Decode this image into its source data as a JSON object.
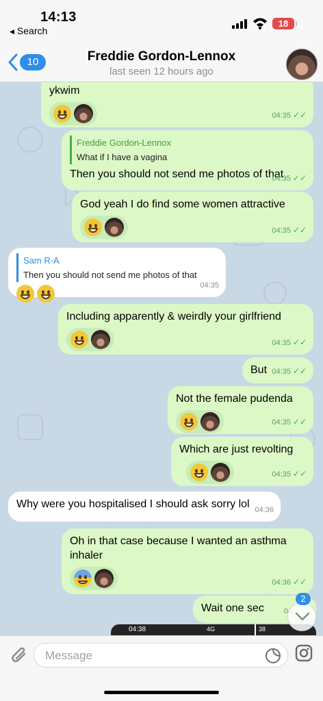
{
  "status_bar": {
    "time": "14:13",
    "back_label": "Search",
    "battery": "18"
  },
  "header": {
    "back_count": "10",
    "title": "Freddie Gordon-Lennox",
    "subtitle": "last seen 12 hours ago"
  },
  "messages": [
    {
      "side": "out",
      "text": "ykwim",
      "time": "04:35"
    },
    {
      "side": "out",
      "quote_name": "Freddie Gordon-Lennox",
      "quote_text": "What if I have a vagina",
      "text": "Then you should not send me photos of that",
      "time": "04:35"
    },
    {
      "side": "out",
      "text": "God yeah I do find some women attractive",
      "time": "04:35"
    },
    {
      "side": "in",
      "quote_name": "Sam R-A",
      "quote_text": "Then you should not send me photos of that",
      "time": "04:35"
    },
    {
      "side": "out",
      "text": "Including apparently & weirdly your girlfriend",
      "time": "04:35"
    },
    {
      "side": "out",
      "text": "But",
      "time": "04:35"
    },
    {
      "side": "out",
      "text": "Not the female pudenda",
      "time": "04:35"
    },
    {
      "side": "out",
      "text": "Which are just revolting",
      "time": "04:35"
    },
    {
      "side": "in",
      "text": "Why were you hospitalised I should ask sorry lol",
      "time": "04:36"
    },
    {
      "side": "out",
      "text": "Oh in that case because I wanted an asthma inhaler",
      "time": "04:36"
    },
    {
      "side": "out",
      "text": "Wait one sec",
      "time": "04:"
    }
  ],
  "scroll": {
    "unread": "2"
  },
  "preview": {
    "left": "04:38",
    "mid": "4G",
    "right": "38"
  },
  "composer": {
    "placeholder": "Message"
  },
  "icons": [
    "chevron-left-icon",
    "wifi-icon",
    "signal-icon",
    "paperclip-icon",
    "sticker-icon",
    "instagram-icon",
    "chevron-down-icon"
  ]
}
